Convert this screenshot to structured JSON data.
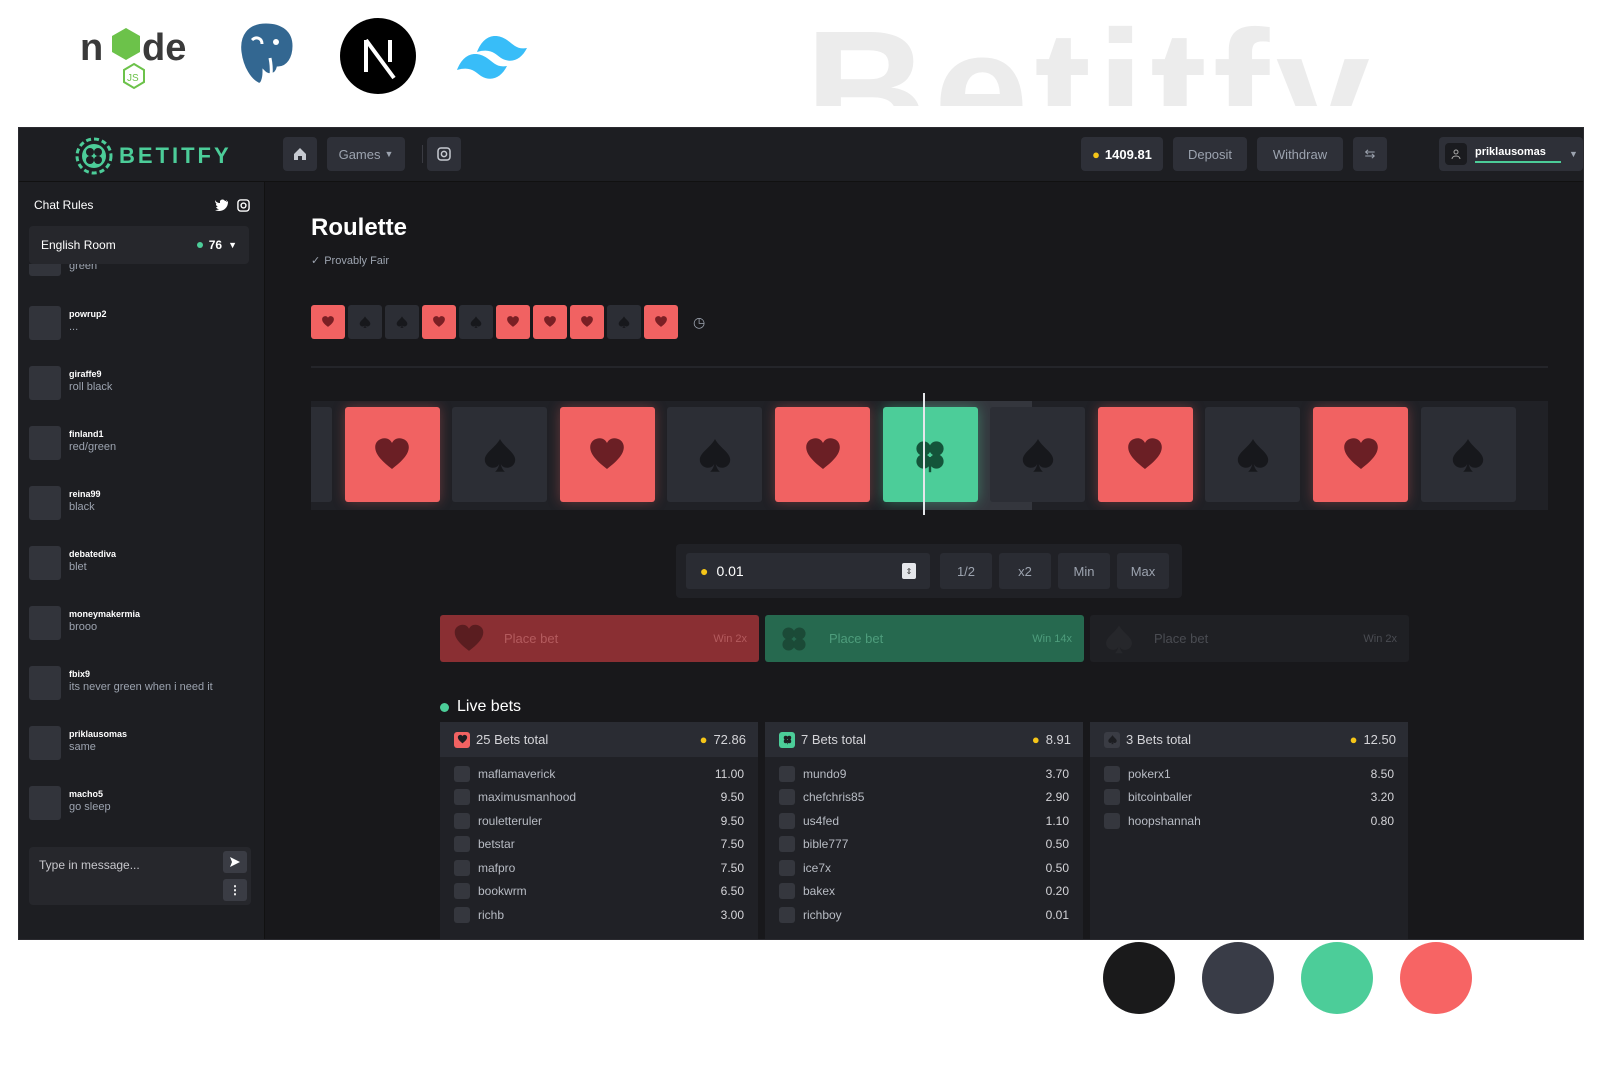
{
  "watermark": "Betitfy",
  "palette": [
    "#1a1a1b",
    "#393c47",
    "#4ccd99",
    "#f76464"
  ],
  "topbar": {
    "brand": "BETITFY",
    "games_label": "Games",
    "balance": "1409.81",
    "deposit_label": "Deposit",
    "withdraw_label": "Withdraw",
    "username": "priklausomas"
  },
  "chat": {
    "rules_label": "Chat Rules",
    "room_label": "English Room",
    "online_count": "76",
    "partial_text": "green",
    "messages": [
      {
        "user": "powrup2",
        "text": "..."
      },
      {
        "user": "giraffe9",
        "text": "roll black"
      },
      {
        "user": "finland1",
        "text": "red/green"
      },
      {
        "user": "reina99",
        "text": "black"
      },
      {
        "user": "debatediva",
        "text": "blet"
      },
      {
        "user": "moneymakermia",
        "text": "brooo"
      },
      {
        "user": "fbix9",
        "text": "its never green when i need it"
      },
      {
        "user": "priklausomas",
        "text": "same"
      },
      {
        "user": "macho5",
        "text": "go sleep"
      }
    ],
    "input_placeholder": "Type in message..."
  },
  "game": {
    "title": "Roulette",
    "provably_fair": "Provably Fair",
    "history": [
      "red",
      "black",
      "black",
      "red",
      "black",
      "red",
      "red",
      "red",
      "black",
      "red"
    ],
    "strip": [
      "black",
      "red",
      "black",
      "red",
      "black",
      "red",
      "green",
      "black",
      "red",
      "black",
      "red",
      "black"
    ],
    "bet_amount": "0.01",
    "quick_buttons": [
      "1/2",
      "x2",
      "Min",
      "Max"
    ],
    "place_bets": [
      {
        "suit": "red",
        "label": "Place bet",
        "mult": "Win 2x"
      },
      {
        "suit": "green",
        "label": "Place bet",
        "mult": "Win 14x"
      },
      {
        "suit": "black",
        "label": "Place bet",
        "mult": "Win 2x"
      }
    ]
  },
  "live_bets": {
    "title": "Live bets",
    "columns": [
      {
        "suit": "red",
        "total_label": "25 Bets total",
        "sum": "72.86",
        "bets": [
          [
            "maflamaverick",
            "11.00"
          ],
          [
            "maximusmanhood",
            "9.50"
          ],
          [
            "rouletteruler",
            "9.50"
          ],
          [
            "betstar",
            "7.50"
          ],
          [
            "mafpro",
            "7.50"
          ],
          [
            "bookwrm",
            "6.50"
          ],
          [
            "richb",
            "3.00"
          ]
        ]
      },
      {
        "suit": "green",
        "total_label": "7 Bets total",
        "sum": "8.91",
        "bets": [
          [
            "mundo9",
            "3.70"
          ],
          [
            "chefchris85",
            "2.90"
          ],
          [
            "us4fed",
            "1.10"
          ],
          [
            "bible777",
            "0.50"
          ],
          [
            "ice7x",
            "0.50"
          ],
          [
            "bakex",
            "0.20"
          ],
          [
            "richboy",
            "0.01"
          ]
        ]
      },
      {
        "suit": "black",
        "total_label": "3 Bets total",
        "sum": "12.50",
        "bets": [
          [
            "pokerx1",
            "8.50"
          ],
          [
            "bitcoinballer",
            "3.20"
          ],
          [
            "hoopshannah",
            "0.80"
          ]
        ]
      }
    ]
  }
}
